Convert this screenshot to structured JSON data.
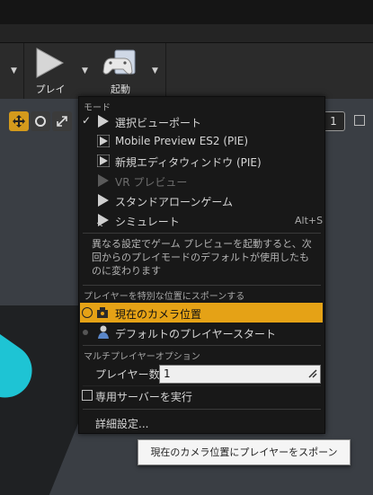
{
  "toolbar": {
    "play_label": "プレイ",
    "launch_label": "起動"
  },
  "viewport": {
    "right_value": "1"
  },
  "menu": {
    "mode_header": "モード",
    "items": [
      {
        "label": "選択ビューポート",
        "checked": true
      },
      {
        "label": "Mobile Preview ES2 (PIE)"
      },
      {
        "label": "新規エディタウィンドウ (PIE)"
      },
      {
        "label": "VR プレビュー",
        "disabled": true
      },
      {
        "label": "スタンドアローンゲーム"
      },
      {
        "label": "シミュレート",
        "shortcut": "Alt+S"
      }
    ],
    "description": "異なる設定でゲーム プレビューを起動すると、次回からのプレイモードのデフォルトが使用したものに変わります",
    "spawn_header": "プレイヤーを特別な位置にスポーンする",
    "spawn_items": [
      {
        "label": "現在のカメラ位置",
        "selected": true
      },
      {
        "label": "デフォルトのプレイヤースタート",
        "selected": false
      }
    ],
    "multiplayer_header": "マルチプレイヤーオプション",
    "player_count_label": "プレイヤー数",
    "player_count_value": "1",
    "dedicated_server_label": "専用サーバーを実行",
    "advanced_settings_label": "詳細設定..."
  },
  "tooltip": "現在のカメラ位置にプレイヤーをスポーン",
  "colors": {
    "highlight": "#e5a216",
    "menu_bg": "#181818"
  }
}
